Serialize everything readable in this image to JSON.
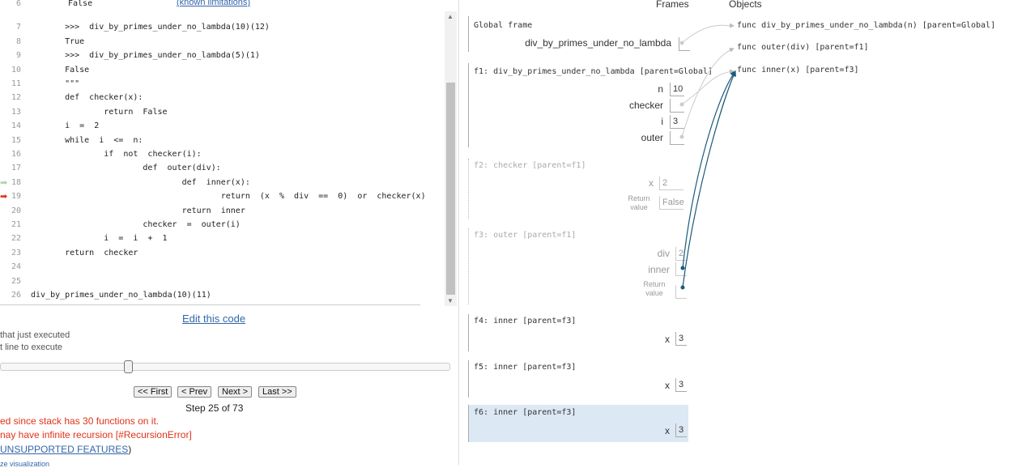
{
  "code": {
    "limitations_link": "(known limitations)",
    "lines": [
      {
        "num": "6",
        "text": "False"
      },
      {
        "num": "7",
        "text": "    >>>  div_by_primes_under_no_lambda(10)(12)"
      },
      {
        "num": "8",
        "text": "    True"
      },
      {
        "num": "9",
        "text": "    >>>  div_by_primes_under_no_lambda(5)(1)"
      },
      {
        "num": "10",
        "text": "    False"
      },
      {
        "num": "11",
        "text": "    \"\"\""
      },
      {
        "num": "12",
        "text": "    def  checker(x):"
      },
      {
        "num": "13",
        "text": "            return  False"
      },
      {
        "num": "14",
        "text": "    i  =  2"
      },
      {
        "num": "15",
        "text": "    while  i  <=  n:"
      },
      {
        "num": "16",
        "text": "            if  not  checker(i):"
      },
      {
        "num": "17",
        "text": "                    def  outer(div):"
      },
      {
        "num": "18",
        "text": "                            def  inner(x):"
      },
      {
        "num": "19",
        "text": "                                    return  (x  %  div  ==  0)  or  checker(x)"
      },
      {
        "num": "20",
        "text": "                            return  inner"
      },
      {
        "num": "21",
        "text": "                    checker  =  outer(i)"
      },
      {
        "num": "22",
        "text": "            i  =  i  +  1"
      },
      {
        "num": "23",
        "text": "    return  checker"
      },
      {
        "num": "24",
        "text": ""
      },
      {
        "num": "25",
        "text": ""
      },
      {
        "num": "26",
        "text": "div_by_primes_under_no_lambda(10)(11)"
      }
    ],
    "prev_arrow_color": "#a8d8a8",
    "next_arrow_color": "#e0331a"
  },
  "controls": {
    "edit_link": "Edit this code",
    "legend_prev": "that just executed",
    "legend_next": "t line to execute",
    "first": "<< First",
    "prev": "< Prev",
    "next": "Next >",
    "last": "Last >>",
    "step": "Step 25 of 73",
    "slider_fraction": 0.33,
    "error1": "ed since stack has 30 functions on it.",
    "error2": "nay have infinite recursion [#RecursionError]",
    "error3_link": "UNSUPPORTED FEATURES",
    "error3_tail": ")",
    "bottom_link": "ze visualization"
  },
  "viz": {
    "frames_header": "Frames",
    "objects_header": "Objects",
    "global": {
      "title": "Global frame",
      "var": "div_by_primes_under_no_lambda"
    },
    "f1": {
      "title": "f1: div_by_primes_under_no_lambda [parent=Global]",
      "vars": [
        {
          "name": "n",
          "value": "10"
        },
        {
          "name": "checker",
          "value": ""
        },
        {
          "name": "i",
          "value": "3"
        },
        {
          "name": "outer",
          "value": ""
        }
      ]
    },
    "f2": {
      "title": "f2: checker [parent=f1]",
      "var_x": "x",
      "val_x": "2",
      "return_label": "Return\nvalue",
      "return_val": "False"
    },
    "f3": {
      "title": "f3: outer [parent=f1]",
      "var_div": "div",
      "val_div": "2",
      "var_inner": "inner",
      "return_label": "Return\nvalue"
    },
    "f4": {
      "title": "f4: inner [parent=f3]",
      "var_x": "x",
      "val_x": "3"
    },
    "f5": {
      "title": "f5: inner [parent=f3]",
      "var_x": "x",
      "val_x": "3"
    },
    "f6": {
      "title": "f6: inner [parent=f3]",
      "var_x": "x",
      "val_x": "3"
    },
    "objects": [
      "func div_by_primes_under_no_lambda(n) [parent=Global]",
      "func outer(div) [parent=f1]",
      "func inner(x) [parent=f3]"
    ],
    "pointer_color": "#cccccc",
    "active_pointer_color": "#1a5a7a",
    "highlight_color": "#dce8f4"
  }
}
